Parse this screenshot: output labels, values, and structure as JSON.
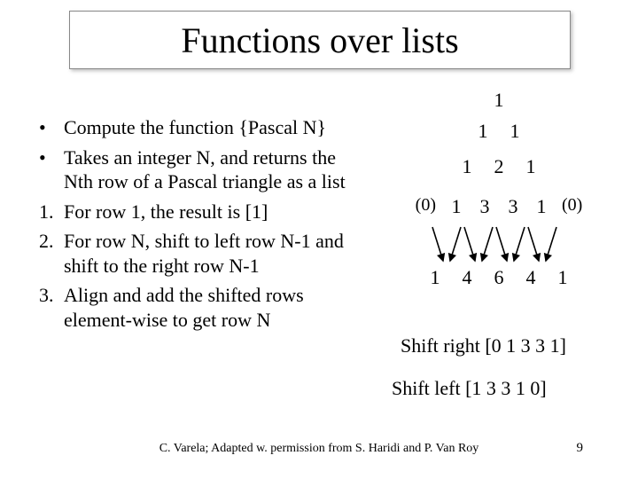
{
  "title": "Functions over lists",
  "bullets": [
    {
      "marker": "•",
      "text": "Compute the function {Pascal N}"
    },
    {
      "marker": "•",
      "text": "Takes an integer N, and returns the Nth row of a Pascal triangle as a list"
    },
    {
      "marker": "1.",
      "text": "For row 1, the result is [1]"
    },
    {
      "marker": "2.",
      "text": "For row N, shift to left row N-1 and shift to the right row N-1"
    },
    {
      "marker": "3.",
      "text": "Align and add the shifted rows element-wise to get row N"
    }
  ],
  "pascal": {
    "row1": [
      "1"
    ],
    "row2": [
      "1",
      "1"
    ],
    "row3": [
      "1",
      "2",
      "1"
    ],
    "row4_leading": "(0)",
    "row4": [
      "1",
      "3",
      "3",
      "1"
    ],
    "row4_trailing": "(0)",
    "row5": [
      "1",
      "4",
      "6",
      "4",
      "1"
    ]
  },
  "shift_right_label": "Shift right",
  "shift_right_value": "[0 1 3 3 1]",
  "shift_left_label": "Shift left",
  "shift_left_value": "[1 3 3 1 0]",
  "footer": "C. Varela;  Adapted w. permission from S. Haridi and P. Van Roy",
  "page_number": "9"
}
